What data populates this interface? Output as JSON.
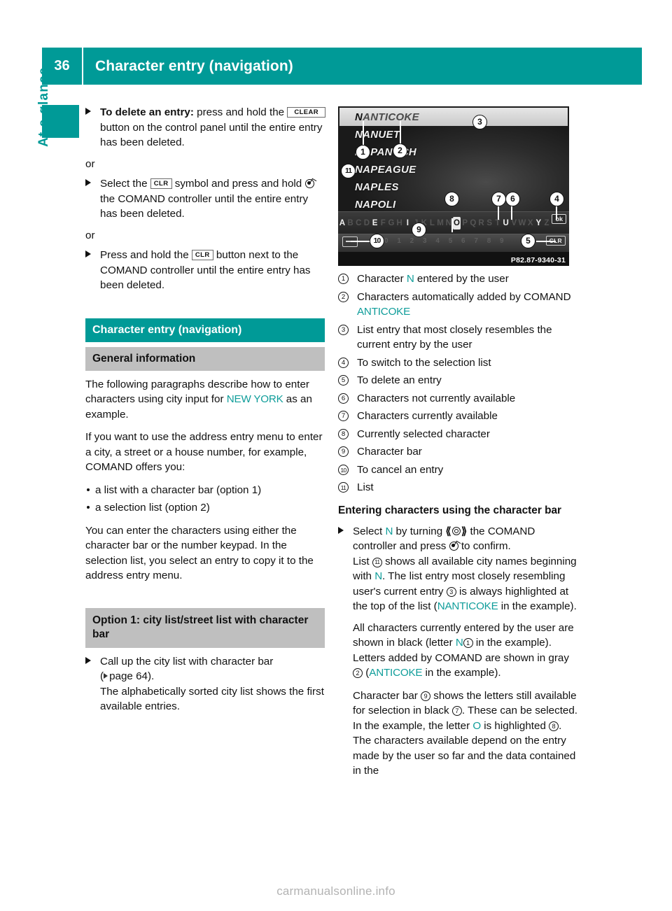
{
  "header": {
    "page_number": "36",
    "title": "Character entry (navigation)",
    "accent_color": "#009a97"
  },
  "sidebar": {
    "chapter_label": "At a glance",
    "tab_color": "#009a97"
  },
  "left_column": {
    "steps": [
      {
        "lead_bold": "To delete an entry:",
        "text_a": " press and hold the",
        "key": "CLEAR",
        "text_b": " button on the control panel until the entire entry has been deleted."
      },
      {
        "or": "or",
        "text_a": "Select the",
        "key": "CLR",
        "text_b": " symbol and press and hold",
        "glyph": "comand-press-icon",
        "text_c": " the COMAND controller until the entire entry has been deleted."
      },
      {
        "or": "or",
        "text_a": "Press and hold the",
        "key": "CLR",
        "text_b": " button next to the COMAND controller until the entire entry has been deleted."
      }
    ],
    "heading_teal": "Character entry (navigation)",
    "heading_gray": "General information",
    "paragraph_1_a": "The following paragraphs describe how to enter characters using city input for ",
    "paragraph_1_highlight": "NEW YORK",
    "paragraph_1_b": " as an example.",
    "paragraph_2": "If you want to use the address entry menu to enter a city, a street or a house number, for example, COMAND offers you:",
    "bullets": [
      "a list with a character bar (option 1)",
      "a selection list (option 2)"
    ],
    "paragraph_3": "You can enter the characters using either the character bar or the number keypad. In the selection list, you select an entry to copy it to the address entry menu.",
    "heading_option1": "Option 1: city list/street list with character bar",
    "option1_step_a": "Call up the city list with character bar",
    "option1_page_ref": "page 64",
    "option1_step_b": "The alphabetically sorted city list shows the first available entries."
  },
  "screenshot": {
    "image_id": "P82.87-9340-31",
    "entered_char": "N",
    "auto_chars": "ANTICOKE",
    "city_list": [
      "NANTICOKE",
      "NANUET",
      "NAPANOCH",
      "NAPEAGUE",
      "NAPLES",
      "NAPOLI"
    ],
    "char_bar": [
      {
        "c": "A",
        "state": "on"
      },
      {
        "c": "B",
        "state": "dim"
      },
      {
        "c": "C",
        "state": "dim"
      },
      {
        "c": "D",
        "state": "dim"
      },
      {
        "c": "E",
        "state": "on"
      },
      {
        "c": "F",
        "state": "dim"
      },
      {
        "c": "G",
        "state": "dim"
      },
      {
        "c": "H",
        "state": "dim"
      },
      {
        "c": "I",
        "state": "on"
      },
      {
        "c": "J",
        "state": "dim"
      },
      {
        "c": "K",
        "state": "dim"
      },
      {
        "c": "L",
        "state": "dim"
      },
      {
        "c": "M",
        "state": "dim"
      },
      {
        "c": "N",
        "state": "dim"
      },
      {
        "c": "O",
        "state": "sel"
      },
      {
        "c": "P",
        "state": "dim"
      },
      {
        "c": "Q",
        "state": "dim"
      },
      {
        "c": "R",
        "state": "dim"
      },
      {
        "c": "S",
        "state": "dim"
      },
      {
        "c": "T",
        "state": "dim"
      },
      {
        "c": "U",
        "state": "on"
      },
      {
        "c": "V",
        "state": "dim"
      },
      {
        "c": "W",
        "state": "dim"
      },
      {
        "c": "X",
        "state": "dim"
      },
      {
        "c": "Y",
        "state": "on"
      },
      {
        "c": "Z",
        "state": "dim"
      }
    ],
    "ok_label": "ok",
    "clr_label": "CLR",
    "number_row": "0 1 2 3 4 5 6 7 8 9",
    "callouts": [
      "1",
      "2",
      "3",
      "4",
      "5",
      "6",
      "7",
      "8",
      "9",
      "10",
      "11"
    ]
  },
  "legend": [
    {
      "n": "1",
      "text_a": "Character ",
      "hl": "N",
      "text_b": " entered by the user"
    },
    {
      "n": "2",
      "text_a": "Characters automatically added by COMAND ",
      "hl": "ANTICOKE",
      "text_b": ""
    },
    {
      "n": "3",
      "text_a": "List entry that most closely resembles the current entry by the user",
      "hl": "",
      "text_b": ""
    },
    {
      "n": "4",
      "text_a": "To switch to the selection list",
      "hl": "",
      "text_b": ""
    },
    {
      "n": "5",
      "text_a": "To delete an entry",
      "hl": "",
      "text_b": ""
    },
    {
      "n": "6",
      "text_a": "Characters not currently available",
      "hl": "",
      "text_b": ""
    },
    {
      "n": "7",
      "text_a": "Characters currently available",
      "hl": "",
      "text_b": ""
    },
    {
      "n": "8",
      "text_a": "Currently selected character",
      "hl": "",
      "text_b": ""
    },
    {
      "n": "9",
      "text_a": "Character bar",
      "hl": "",
      "text_b": ""
    },
    {
      "n": "10",
      "text_a": "To cancel an entry",
      "hl": "",
      "text_b": ""
    },
    {
      "n": "11",
      "text_a": "List",
      "hl": "",
      "text_b": ""
    }
  ],
  "right_column": {
    "heading": "Entering characters using the character bar",
    "step_select_a": "Select ",
    "step_select_n": "N",
    "step_select_b": " by turning ",
    "step_select_c": " the COMAND controller and press ",
    "step_select_d": " to confirm.",
    "step_list_a": "List ",
    "step_list_num": "11",
    "step_list_b": " shows all available city names beginning with ",
    "step_list_n": "N",
    "step_list_c": ". The list entry most closely resembling user's current entry ",
    "step_list_num2": "3",
    "step_list_d": " is always highlighted at the top of the list (",
    "step_list_hl": "NANTICOKE",
    "step_list_e": " in the example).",
    "para_black_a": "All characters currently entered by the user are shown in black (letter ",
    "para_black_n": "N",
    "para_black_num": "1",
    "para_black_b": " in the example). Letters added by COMAND are shown in gray ",
    "para_black_num2": "2",
    "para_black_c": " (",
    "para_black_hl": "ANTICOKE",
    "para_black_d": " in the example).",
    "para_bar_a": "Character bar ",
    "para_bar_num": "9",
    "para_bar_b": " shows the letters still available for selection in black ",
    "para_bar_num2": "7",
    "para_bar_c": ". These can be selected. In the example, the letter ",
    "para_bar_o": "O",
    "para_bar_d": " is highlighted ",
    "para_bar_num3": "8",
    "para_bar_e": ". The characters available depend on the entry made by the user so far and the data contained in the"
  },
  "footer": {
    "watermark": "carmanualsonline.info"
  }
}
